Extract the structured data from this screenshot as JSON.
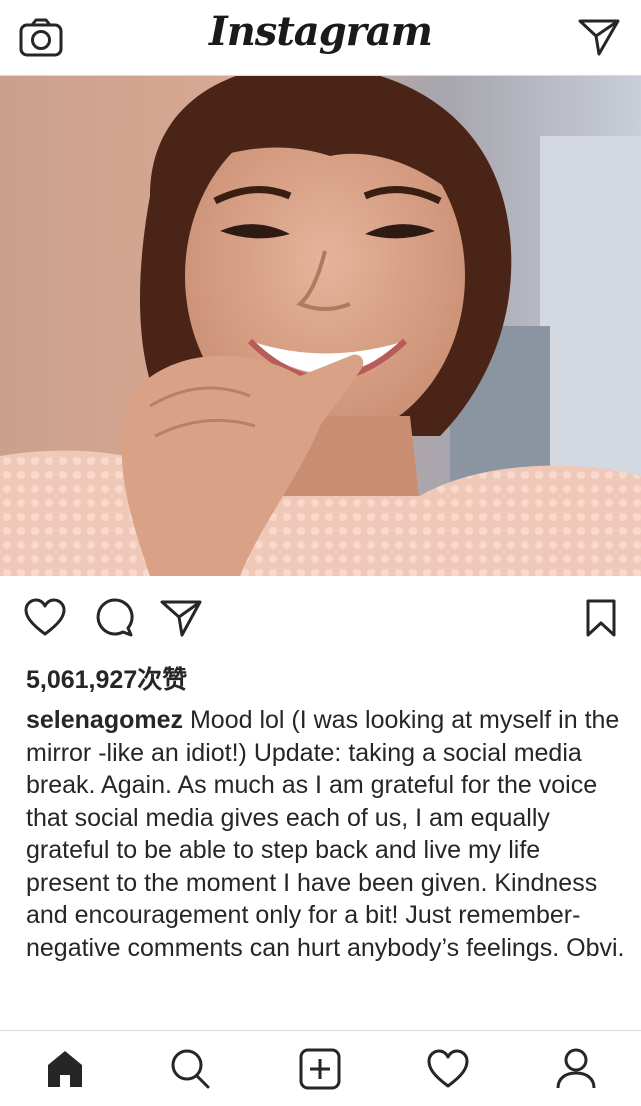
{
  "header": {
    "app_title": "Instagram",
    "left_icon": "camera-icon",
    "right_icon": "direct-message-icon"
  },
  "post": {
    "likes_text": "5,061,927次赞",
    "username": "selenagomez",
    "caption": "Mood lol (I was looking at myself in the mirror -like an idiot!) Update: taking a social media break. Again. As much as I am grateful for the voice that social media gives each of us, I am equally grateful to be able to step back and live my life present to the moment I have been given. Kindness and encouragement only for a bit! Just remember- negative comments can hurt anybody’s feelings. Obvi.",
    "action_icons": [
      "heart-icon",
      "comment-icon",
      "share-icon",
      "bookmark-icon"
    ]
  },
  "tab_bar": {
    "items": [
      "home-icon",
      "search-icon",
      "add-post-icon",
      "activity-heart-icon",
      "profile-icon"
    ],
    "active": "home-icon"
  },
  "colors": {
    "text": "#262626",
    "divider": "#dbdbdb",
    "background": "#ffffff"
  }
}
